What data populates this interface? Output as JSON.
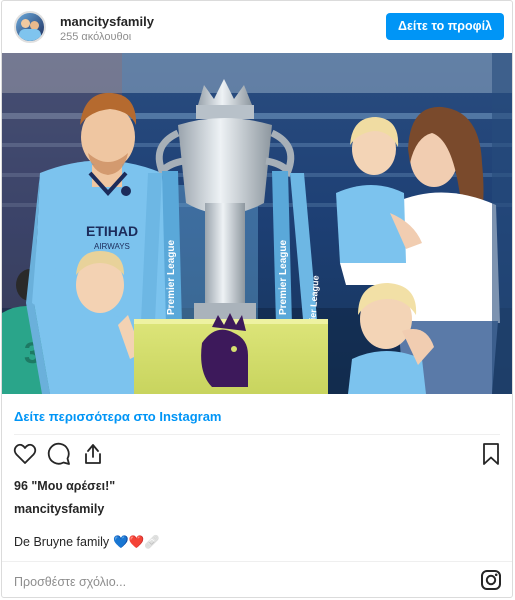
{
  "header": {
    "username": "mancitysfamily",
    "followers": "255 ακόλουθοι",
    "profile_button": "Δείτε το προφίλ"
  },
  "photo": {
    "shirt_sponsor": "ETIHAD",
    "shirt_sponsor_sub": "AIRWAYS",
    "ribbon_text": "Premier League",
    "colors": {
      "sky_blue": "#7cc3ee",
      "navy": "#1c2c5b",
      "stadium_blue": "#1b3d6e",
      "trophy_silver": "#cfd6dd",
      "plinth_yellow": "#d6e070",
      "pl_purple": "#3d195b"
    }
  },
  "post": {
    "more_link": "Δείτε περισσότερα στο Instagram",
    "likes": "96 \"Μου αρέσει!\"",
    "owner": "mancitysfamily",
    "caption": "De Bruyne family",
    "caption_emojis": "💙❤️🩹",
    "comment_placeholder": "Προσθέστε σχόλιο..."
  },
  "icons": {
    "like": "heart-icon",
    "comment": "comment-icon",
    "share": "share-icon",
    "save": "bookmark-icon",
    "instagram": "instagram-icon"
  },
  "colors": {
    "accent": "#0095f6",
    "text": "#262626",
    "muted": "#8e8e8e",
    "border": "#dbdbdb"
  }
}
